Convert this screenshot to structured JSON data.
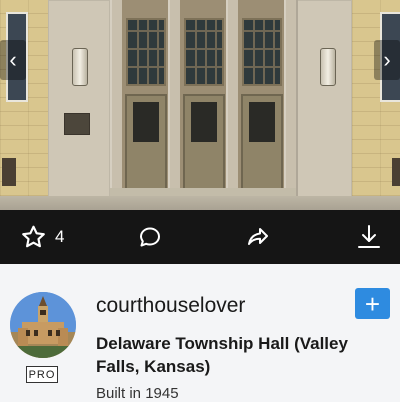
{
  "photo": {
    "prev_glyph": "‹",
    "next_glyph": "›"
  },
  "actions": {
    "favorite_icon": "star-outline-icon",
    "favorite_count": "4",
    "comment_icon": "comment-bubble-icon",
    "share_icon": "share-arrow-icon",
    "download_icon": "download-arrow-icon"
  },
  "post": {
    "username": "courthouselover",
    "badge": "PRO",
    "follow_label": "+",
    "place_name": "Delaware Township Hall (Valley Falls, Kansas)",
    "description": "Built in 1945"
  },
  "colors": {
    "action_bar_bg": "#151515",
    "follow_button": "#2e8be0",
    "content_bg": "#f4f5f7"
  }
}
